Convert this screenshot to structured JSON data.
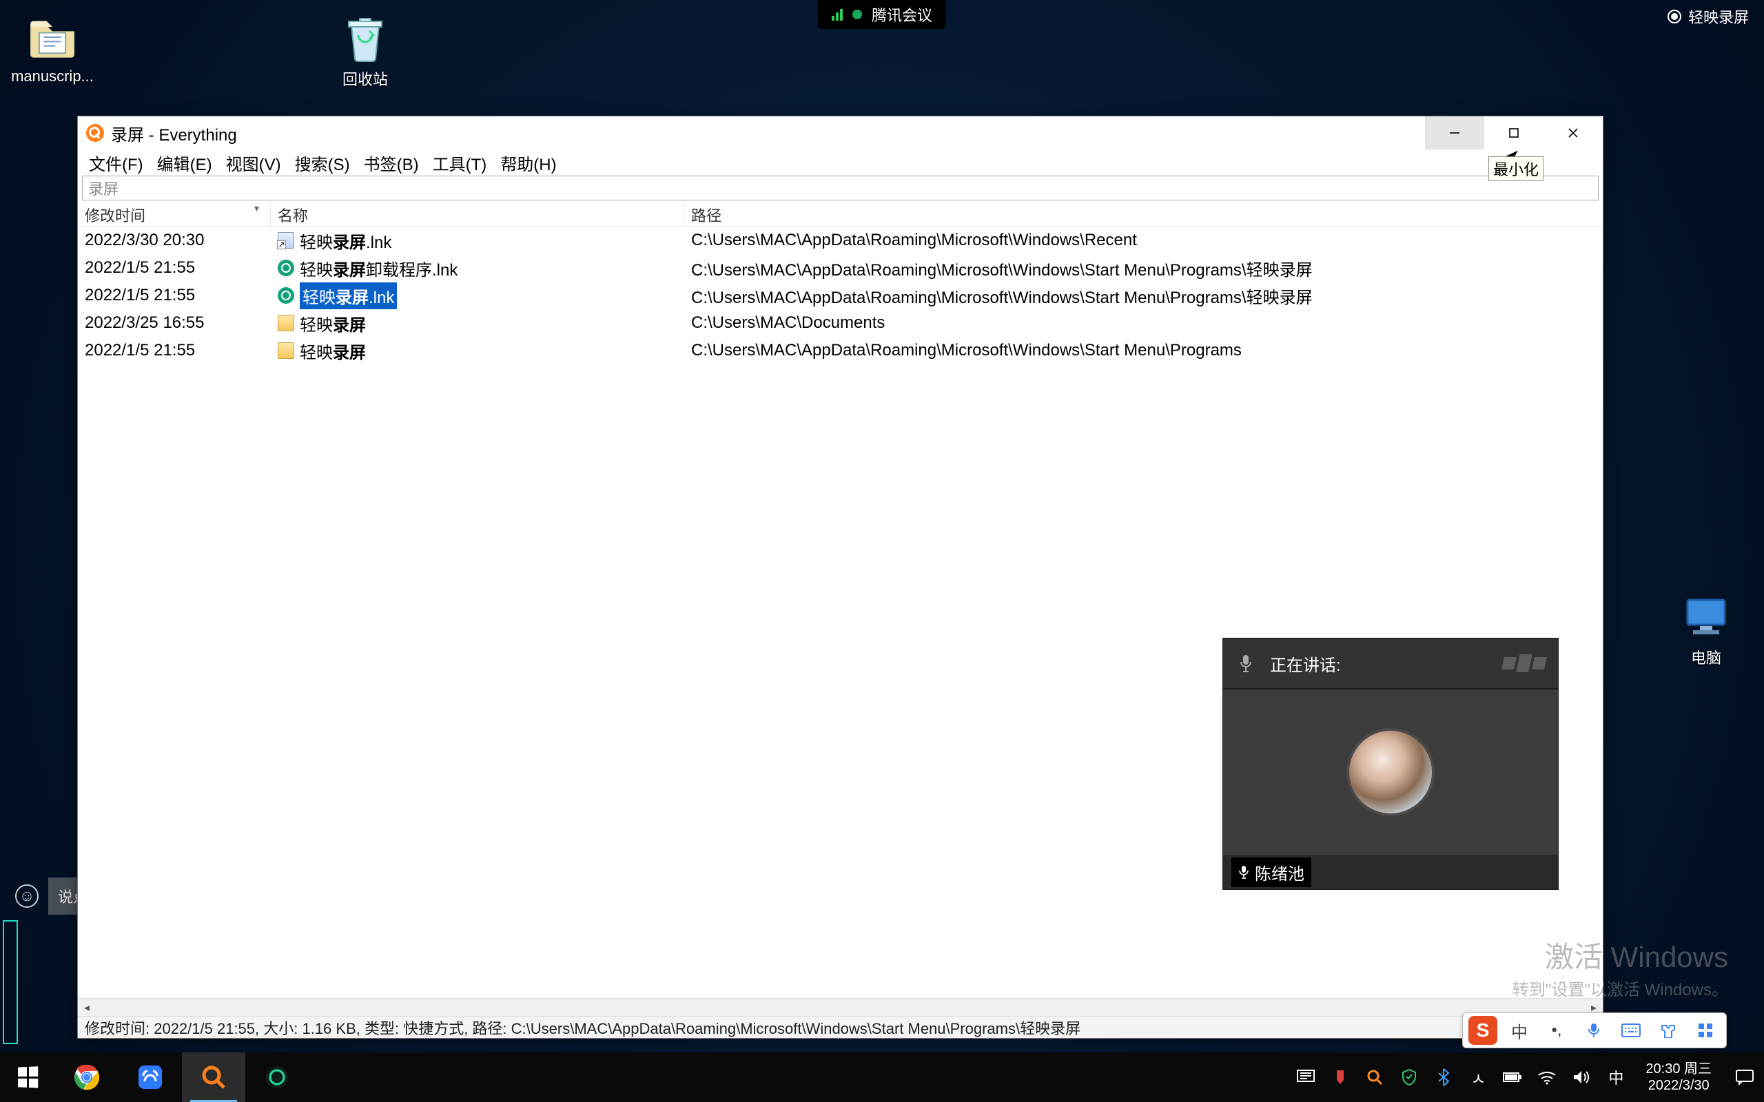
{
  "desktop": {
    "manuscript_label": "manuscrip...",
    "recycle_label": "回收站",
    "thispc_label": "电脑"
  },
  "meeting_pill": {
    "label": "腾讯会议"
  },
  "recorder_badge": {
    "label": "轻映录屏"
  },
  "chat": {
    "placeholder": "说点什么..."
  },
  "window": {
    "title_search": "录屏",
    "title_app": " - Everything",
    "menu": [
      "文件(F)",
      "编辑(E)",
      "视图(V)",
      "搜索(S)",
      "书签(B)",
      "工具(T)",
      "帮助(H)"
    ],
    "search_value": "录屏",
    "columns": {
      "date": "修改时间",
      "name": "名称",
      "path": "路径"
    },
    "rows": [
      {
        "date": "2022/3/30 20:30",
        "icon": "shortcut",
        "name_pre": "轻映",
        "name_hl": "录屏",
        "name_post": ".lnk",
        "path": "C:\\Users\\MAC\\AppData\\Roaming\\Microsoft\\Windows\\Recent",
        "selected": false
      },
      {
        "date": "2022/1/5 21:55",
        "icon": "app",
        "name_pre": "轻映",
        "name_hl": "录屏",
        "name_post": "卸载程序.lnk",
        "path": "C:\\Users\\MAC\\AppData\\Roaming\\Microsoft\\Windows\\Start Menu\\Programs\\轻映录屏",
        "selected": false
      },
      {
        "date": "2022/1/5 21:55",
        "icon": "app",
        "name_pre": "轻映",
        "name_hl": "录屏",
        "name_post": ".lnk",
        "path": "C:\\Users\\MAC\\AppData\\Roaming\\Microsoft\\Windows\\Start Menu\\Programs\\轻映录屏",
        "selected": true
      },
      {
        "date": "2022/3/25 16:55",
        "icon": "folder",
        "name_pre": "轻映",
        "name_hl": "录屏",
        "name_post": "",
        "path": "C:\\Users\\MAC\\Documents",
        "selected": false
      },
      {
        "date": "2022/1/5 21:55",
        "icon": "folder",
        "name_pre": "轻映",
        "name_hl": "录屏",
        "name_post": "",
        "path": "C:\\Users\\MAC\\AppData\\Roaming\\Microsoft\\Windows\\Start Menu\\Programs",
        "selected": false
      }
    ],
    "tooltip": "最小化",
    "statusbar": "修改时间: 2022/1/5 21:55,  大小: 1.16 KB,  类型: 快捷方式,  路径: C:\\Users\\MAC\\AppData\\Roaming\\Microsoft\\Windows\\Start Menu\\Programs\\轻映录屏"
  },
  "video": {
    "speaking_label": "正在讲话:",
    "participant": "陈绪池"
  },
  "watermark": {
    "line1": "激活 Windows",
    "line2": "转到\"设置\"以激活 Windows。"
  },
  "ime": {
    "lang": "中"
  },
  "taskbar": {
    "time": "20:30 周三",
    "date": "2022/3/30",
    "tray_lang": "中"
  }
}
